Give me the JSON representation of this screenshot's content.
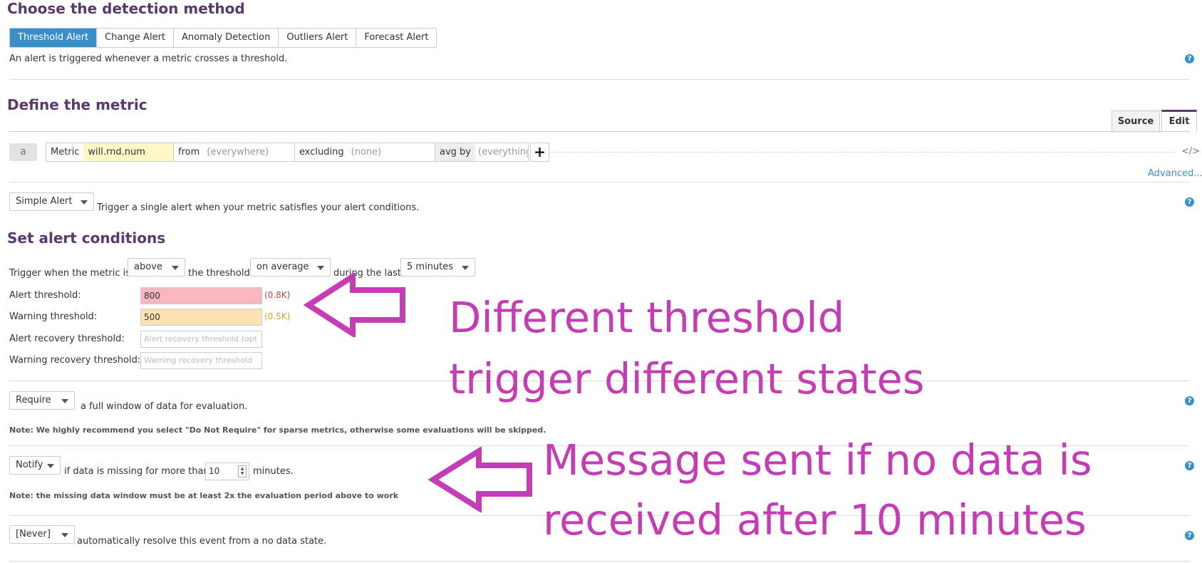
{
  "detection": {
    "title": "Choose the detection method",
    "tabs": [
      "Threshold Alert",
      "Change Alert",
      "Anomaly Detection",
      "Outliers Alert",
      "Forecast Alert"
    ],
    "active_tab": "Threshold Alert",
    "description": "An alert is triggered whenever a metric crosses a threshold."
  },
  "metric": {
    "title": "Define the metric",
    "source_label": "Source",
    "edit_label": "Edit",
    "query_letter": "a",
    "metric_key": "Metric",
    "metric_value": "will.rnd.num",
    "from_key": "from",
    "from_value": "(everywhere)",
    "excluding_key": "excluding",
    "excluding_value": "(none)",
    "avgby_key": "avg by",
    "avgby_value": "(everything)",
    "add_label": "+",
    "code_icon": "</>",
    "advanced_link": "Advanced..."
  },
  "alert_type": {
    "select": "Simple Alert",
    "description": "Trigger a single alert when your metric satisfies your alert conditions."
  },
  "conditions": {
    "title": "Set alert conditions",
    "trigger_prefix": "Trigger when the metric is",
    "comparison": "above",
    "threshold_word": "the threshold",
    "aggregation": "on average",
    "during_word": "during the last",
    "window": "5 minutes",
    "alert_threshold_label": "Alert threshold:",
    "alert_threshold_value": "800",
    "alert_threshold_hint": "(0.8K)",
    "warning_threshold_label": "Warning threshold:",
    "warning_threshold_value": "500",
    "warning_threshold_hint": "(0.5K)",
    "alert_recovery_label": "Alert recovery threshold:",
    "alert_recovery_placeholder": "Alert recovery threshold (opt",
    "warning_recovery_label": "Warning recovery threshold:",
    "warning_recovery_placeholder": "Warning recovery threshold"
  },
  "require": {
    "select": "Require",
    "description": "a full window of data for evaluation.",
    "note": "Note: We highly recommend you select \"Do Not Require\" for sparse metrics, otherwise some evaluations will be skipped."
  },
  "nodata": {
    "select": "Notify",
    "description": "if data is missing for more than",
    "minutes_value": "10",
    "minutes_label": "minutes.",
    "note": "Note: the missing data window must be at least 2x the evaluation period above to work"
  },
  "resolve": {
    "select": "[Never]",
    "description": "automatically resolve this event from a no data state."
  },
  "help_glyph": "?",
  "annotations": {
    "threshold_line1": "Different threshold",
    "threshold_line2": "trigger different states",
    "nodata_line1": "Message sent if no data is",
    "nodata_line2": "received after 10 minutes",
    "color": "#c43db4"
  },
  "colors": {
    "accent": "#3a8fc9",
    "heading": "#5a3a6e",
    "alert_bg": "#f7b7bf",
    "warning_bg": "#fde2b3",
    "metric_bg": "#fdf8c6"
  }
}
